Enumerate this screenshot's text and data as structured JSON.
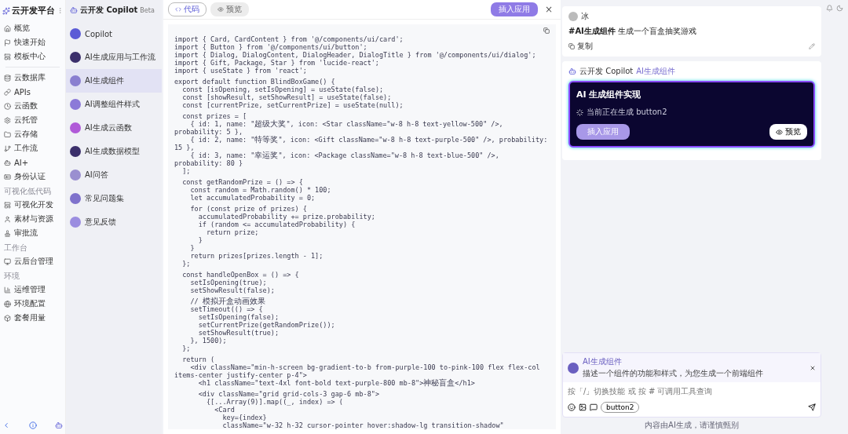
{
  "sidebar": {
    "title": "云开发平台",
    "sections": [
      {
        "items": [
          {
            "label": "概览"
          },
          {
            "label": "快速开始"
          },
          {
            "label": "模板中心"
          }
        ]
      },
      {
        "items": [
          {
            "label": "云数据库"
          },
          {
            "label": "APIs"
          },
          {
            "label": "云函数"
          },
          {
            "label": "云托管"
          },
          {
            "label": "云存储"
          },
          {
            "label": "工作流"
          },
          {
            "label": "AI+"
          },
          {
            "label": "身份认证"
          }
        ]
      },
      {
        "heading": "可视化低代码",
        "items": [
          {
            "label": "可视化开发"
          },
          {
            "label": "素材与资源"
          },
          {
            "label": "审批流"
          }
        ]
      },
      {
        "heading": "工作台",
        "items": [
          {
            "label": "云后台管理"
          }
        ]
      },
      {
        "heading": "环境",
        "items": [
          {
            "label": "运维管理"
          },
          {
            "label": "环境配置"
          },
          {
            "label": "套餐用量"
          }
        ]
      }
    ]
  },
  "copilot": {
    "title": "云开发 Copilot",
    "badge": "Beta",
    "items": [
      {
        "label": "Copilot",
        "selected": false,
        "color": "#5b5bd6"
      },
      {
        "label": "AI生成应用与工作流",
        "selected": false,
        "color": "#3b2f6b"
      },
      {
        "label": "AI生成组件",
        "selected": true,
        "color": "#8a7fd0"
      },
      {
        "label": "AI调整组件样式",
        "selected": false,
        "color": "#8c7ad8"
      },
      {
        "label": "AI生成云函数",
        "selected": false,
        "color": "#b05ad8"
      },
      {
        "label": "AI生成数据模型",
        "selected": false,
        "color": "#3b2f6b"
      },
      {
        "label": "AI问答",
        "selected": false,
        "color": "#9a8fd0"
      },
      {
        "label": "常见问题集",
        "selected": false,
        "color": "#7f72cc"
      },
      {
        "label": "意见反馈",
        "selected": false,
        "color": "#9b8de0"
      }
    ]
  },
  "code_panel": {
    "tabs": [
      {
        "label": "代码",
        "selected": true
      },
      {
        "label": "预览",
        "selected": false
      }
    ],
    "apply_button": "插入应用",
    "close": "×",
    "code_blocks": [
      [
        "import { Card, CardContent } from '@/components/ui/card';",
        "import { Button } from '@/components/ui/button';",
        "import { Dialog, DialogContent, DialogHeader, DialogTitle } from '@/components/ui/dialog';",
        "import { Gift, Package, Star } from 'lucide-react';",
        "import { useState } from 'react';"
      ],
      [
        "export default function BlindBoxGame() {",
        "  const [isOpening, setIsOpening] = useState(false);",
        "  const [showResult, setShowResult] = useState(false);",
        "  const [currentPrize, setCurrentPrize] = useState(null);"
      ],
      [
        "  const prizes = [",
        "    { id: 1, name: \"超级大奖\", icon: <Star className=\"w-8 h-8 text-yellow-500\" />, probability: 5 },",
        "    { id: 2, name: \"特等奖\", icon: <Gift className=\"w-8 h-8 text-purple-500\" />, probability: 15 },",
        "    { id: 3, name: \"幸运奖\", icon: <Package className=\"w-8 h-8 text-blue-500\" />, probability: 80 }",
        "  ];"
      ],
      [
        "  const getRandomPrize = () => {",
        "    const random = Math.random() * 100;",
        "    let accumulatedProbability = 0;"
      ],
      [
        "    for (const prize of prizes) {",
        "      accumulatedProbability += prize.probability;",
        "      if (random <= accumulatedProbability) {",
        "        return prize;",
        "      }",
        "    }",
        "    return prizes[prizes.length - 1];",
        "  };"
      ],
      [
        "  const handleOpenBox = () => {",
        "    setIsOpening(true);",
        "    setShowResult(false);"
      ],
      [
        "    // 模拟开盒动画效果",
        "    setTimeout(() => {",
        "      setIsOpening(false);",
        "      setCurrentPrize(getRandomPrize());",
        "      setShowResult(true);",
        "    }, 1500);",
        "  };"
      ],
      [
        "  return (",
        "    <div className=\"min-h-screen bg-gradient-to-b from-purple-100 to-pink-100 flex flex-col items-center justify-center p-4\">",
        "      <h1 className=\"text-4xl font-bold text-purple-800 mb-8\">神秘盲盒</h1>"
      ],
      [
        "      <div className=\"grid grid-cols-3 gap-6 mb-8\">",
        "        {[...Array(9)].map((_, index) => (",
        "          <Card",
        "            key={index}",
        "            className=\"w-32 h-32 cursor-pointer hover:shadow-lg transition-shadow\""
      ]
    ]
  },
  "chat": {
    "user": {
      "name": "冰",
      "tag": "#AI生成组件",
      "text": "生成一个盲盒抽奖游戏",
      "copy": "复制"
    },
    "bot": {
      "name": "云开发 Copilot",
      "skill": "AI生成组件",
      "card_title": "AI 生成组件实现",
      "status": "当前正在生成 button2",
      "primary": "插入应用",
      "preview": "预览"
    },
    "context": {
      "title": "AI生成组件",
      "desc": "描述一个组件的功能和样式，为您生成一个前端组件"
    },
    "input": {
      "placeholder": "按「/」切换技能 或 按 # 可调用工具查询",
      "chip": "button2"
    },
    "footer": "内容由AI生成，请谨慎甄别"
  }
}
